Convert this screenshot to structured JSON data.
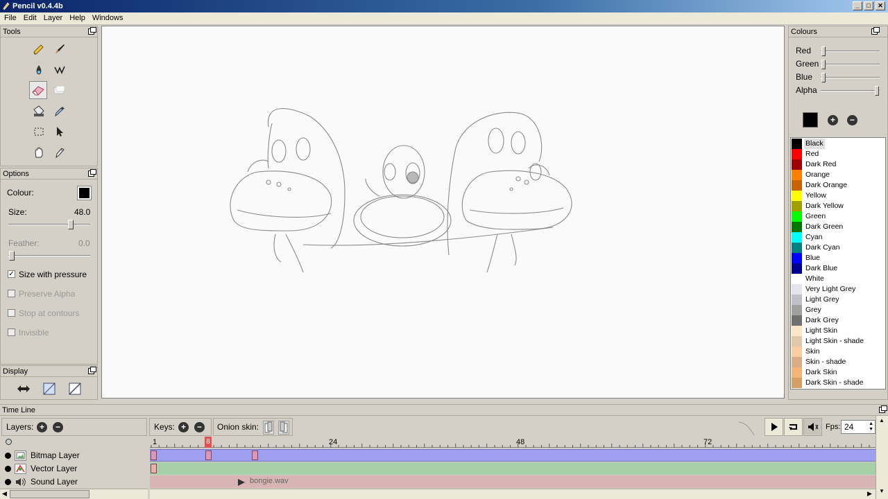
{
  "window": {
    "title": "Pencil v0.4.4b"
  },
  "menu": [
    "File",
    "Edit",
    "Layer",
    "Help",
    "Windows"
  ],
  "tools_panel": {
    "title": "Tools"
  },
  "options_panel": {
    "title": "Options",
    "colour_label": "Colour:",
    "colour_value": "#000000",
    "size_label": "Size:",
    "size_value": "48.0",
    "feather_label": "Feather:",
    "feather_value": "0.0",
    "checkboxes": [
      {
        "label": "Size with pressure",
        "checked": true,
        "enabled": true
      },
      {
        "label": "Preserve Alpha",
        "checked": false,
        "enabled": false
      },
      {
        "label": "Stop at contours",
        "checked": false,
        "enabled": false
      },
      {
        "label": "Invisible",
        "checked": false,
        "enabled": false
      }
    ]
  },
  "display_panel": {
    "title": "Display"
  },
  "colours_panel": {
    "title": "Colours",
    "sliders": [
      {
        "label": "Red",
        "value": 0
      },
      {
        "label": "Green",
        "value": 0
      },
      {
        "label": "Blue",
        "value": 0
      },
      {
        "label": "Alpha",
        "value": 1
      }
    ],
    "current": "#000000",
    "palette": [
      {
        "name": "Black",
        "color": "#000000"
      },
      {
        "name": "Red",
        "color": "#ff0000"
      },
      {
        "name": "Dark Red",
        "color": "#a00000"
      },
      {
        "name": "Orange",
        "color": "#ff8000"
      },
      {
        "name": "Dark Orange",
        "color": "#c86400"
      },
      {
        "name": "Yellow",
        "color": "#ffff00"
      },
      {
        "name": "Dark Yellow",
        "color": "#a0a000"
      },
      {
        "name": "Green",
        "color": "#00ff00"
      },
      {
        "name": "Dark Green",
        "color": "#007800"
      },
      {
        "name": "Cyan",
        "color": "#00ffff"
      },
      {
        "name": "Dark Cyan",
        "color": "#008080"
      },
      {
        "name": "Blue",
        "color": "#0000ff"
      },
      {
        "name": "Dark Blue",
        "color": "#000090"
      },
      {
        "name": "White",
        "color": "#ffffff"
      },
      {
        "name": "Very Light Grey",
        "color": "#e4e4ee"
      },
      {
        "name": "Light Grey",
        "color": "#c0c0c8"
      },
      {
        "name": "Grey",
        "color": "#a0a0a0"
      },
      {
        "name": "Dark Grey",
        "color": "#707070"
      },
      {
        "name": "Light Skin",
        "color": "#fde6c8"
      },
      {
        "name": "Light Skin - shade",
        "color": "#e2c8aa"
      },
      {
        "name": "Skin",
        "color": "#f8cfa0"
      },
      {
        "name": "Skin - shade",
        "color": "#d8ae88"
      },
      {
        "name": "Dark Skin",
        "color": "#f4b478"
      },
      {
        "name": "Dark Skin - shade",
        "color": "#d4a068"
      }
    ]
  },
  "timeline": {
    "title": "Time Line",
    "layers_label": "Layers:",
    "keys_label": "Keys:",
    "onion_label": "Onion skin:",
    "fps_label": "Fps:",
    "fps_value": "24",
    "current_frame": "8",
    "ruler_labels": [
      "1",
      "24",
      "48",
      "72"
    ],
    "layers": [
      {
        "name": "Bitmap Layer",
        "type": "bitmap",
        "color": "#9f9ff0",
        "keyframes": [
          1,
          8,
          14
        ]
      },
      {
        "name": "Vector Layer",
        "type": "vector",
        "color": "#a8d0a8",
        "keyframes": [
          1
        ]
      },
      {
        "name": "Sound Layer",
        "type": "sound",
        "color": "#d8b4b4",
        "sound_file": "bongie.wav"
      }
    ]
  }
}
